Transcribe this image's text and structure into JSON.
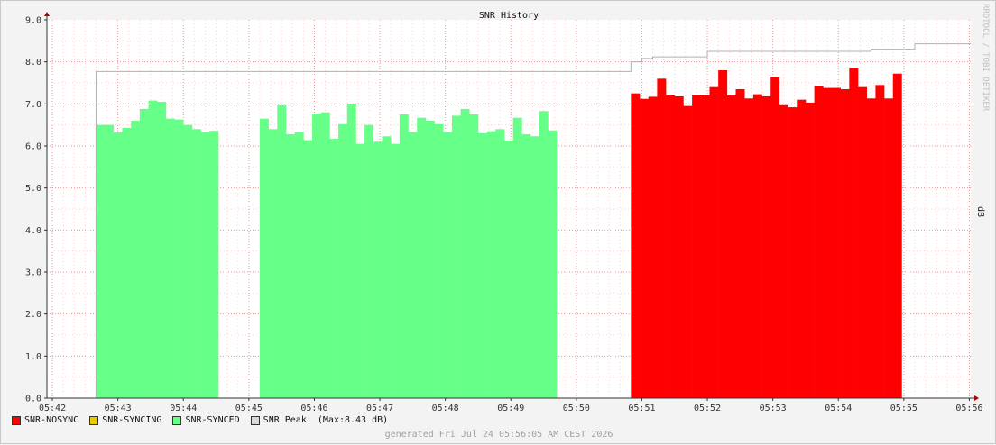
{
  "chart_data": {
    "type": "area",
    "title": "SNR History",
    "ylabel": "dB",
    "ylim": [
      0,
      9
    ],
    "yticks": [
      "0.0",
      "1.0",
      "2.0",
      "3.0",
      "4.0",
      "5.0",
      "6.0",
      "7.0",
      "8.0",
      "9.0"
    ],
    "xticks": [
      "05:42",
      "05:43",
      "05:44",
      "05:45",
      "05:46",
      "05:47",
      "05:48",
      "05:49",
      "05:50",
      "05:51",
      "05:52",
      "05:53",
      "05:54",
      "05:55",
      "05:56"
    ],
    "grid": true,
    "series": [
      {
        "name": "SNR-SYNCED",
        "color": "#66ff88",
        "segments": [
          {
            "start": "05:42:40",
            "step_seconds": 8,
            "values": [
              6.5,
              6.5,
              6.32,
              6.43,
              6.6,
              6.88,
              7.08,
              7.05,
              6.65,
              6.63,
              6.5,
              6.4,
              6.33,
              6.36
            ]
          },
          {
            "start": "05:45:10",
            "step_seconds": 8,
            "values": [
              6.65,
              6.4,
              6.97,
              6.28,
              6.33,
              6.14,
              6.77,
              6.8,
              6.17,
              6.52,
              7.0,
              6.05,
              6.5,
              6.1,
              6.23,
              6.05,
              6.75,
              6.33,
              6.67,
              6.6,
              6.52,
              6.33,
              6.72,
              6.88,
              6.75,
              6.3,
              6.35,
              6.4,
              6.13,
              6.67,
              6.28,
              6.23,
              6.83,
              6.37
            ]
          }
        ]
      },
      {
        "name": "SNR-NOSYNC",
        "color": "#ff0000",
        "segments": [
          {
            "start": "05:50:50",
            "step_seconds": 8,
            "values": [
              7.25,
              7.12,
              7.17,
              7.6,
              7.2,
              7.18,
              6.95,
              7.22,
              7.2,
              7.4,
              7.8,
              7.2,
              7.35,
              7.13,
              7.23,
              7.18,
              7.65,
              6.97,
              6.92,
              7.1,
              7.03,
              7.42,
              7.38,
              7.38,
              7.35,
              7.85,
              7.4,
              7.13,
              7.45,
              7.13,
              7.72
            ]
          }
        ]
      },
      {
        "name": "SNR-SYNCING",
        "color": "#e8c800",
        "segments": []
      },
      {
        "name": "SNR Peak",
        "color": "#b0b0b0",
        "steps": [
          [
            "05:42:40",
            7.77
          ],
          [
            "05:50:50",
            8.0
          ],
          [
            "05:51:00",
            8.08
          ],
          [
            "05:51:10",
            8.12
          ],
          [
            "05:52:00",
            8.25
          ],
          [
            "05:54:30",
            8.3
          ],
          [
            "05:55:10",
            8.43
          ],
          [
            "05:56:00",
            8.43
          ]
        ]
      }
    ]
  },
  "legend": {
    "items": [
      {
        "label": "SNR-NOSYNC",
        "color": "#ff0000"
      },
      {
        "label": "SNR-SYNCING",
        "color": "#e8c800"
      },
      {
        "label": "SNR-SYNCED",
        "color": "#66ff88"
      },
      {
        "label": "SNR Peak  ",
        "color": "#d8d8d8"
      }
    ],
    "max_text": "(Max:8.43 dB)"
  },
  "footer": "generated Fri Jul 24 05:56:05 AM CEST 2026",
  "watermark": "RRDTOOL / TOBI OETIKER"
}
